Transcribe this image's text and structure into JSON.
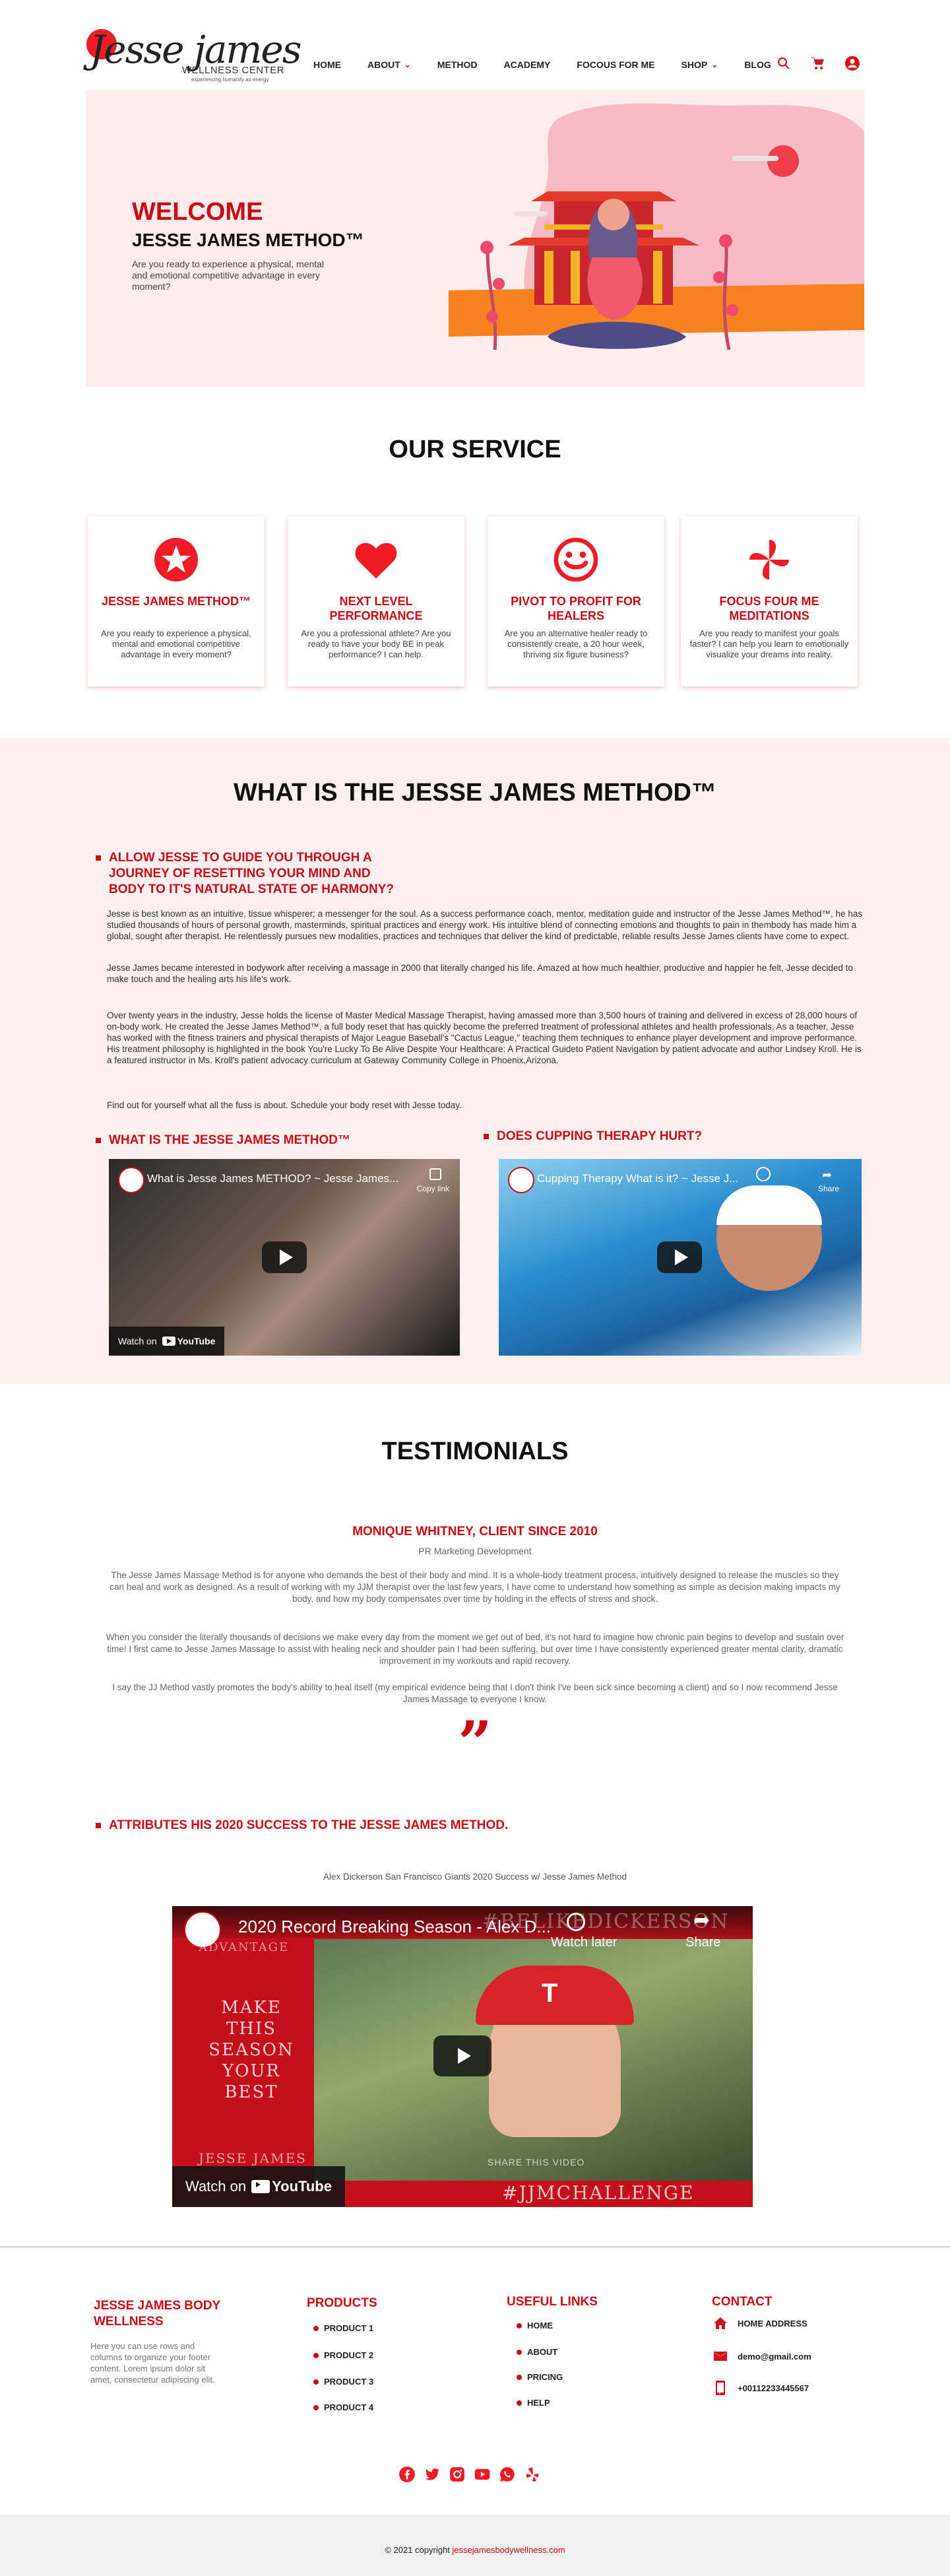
{
  "header": {
    "logo_script": "Jesse james",
    "logo_sub": "WELLNESS CENTER",
    "logo_tag": "experiencing humanity as energy",
    "nav": [
      {
        "label": "HOME",
        "dropdown": false
      },
      {
        "label": "ABOUT",
        "dropdown": true
      },
      {
        "label": "METHOD",
        "dropdown": false
      },
      {
        "label": "ACADEMY",
        "dropdown": false
      },
      {
        "label": "FOCOUS FOR ME",
        "dropdown": false
      },
      {
        "label": "SHOP",
        "dropdown": true
      },
      {
        "label": "BLOG",
        "dropdown": false
      }
    ],
    "icons": [
      "search-icon",
      "cart-icon",
      "account-icon"
    ]
  },
  "hero": {
    "title": "WELCOME",
    "subtitle": "JESSE JAMES METHOD™",
    "text": "Are you ready to experience a physical, mental and emotional competitive advantage in every moment?"
  },
  "service": {
    "title": "OUR SERVICE",
    "cards": [
      {
        "icon": "star-icon",
        "title": "JESSE JAMES METHOD™",
        "text": "Are you ready to experience a physical, mental and emotional competitive advantage in every moment?"
      },
      {
        "icon": "heart-icon",
        "title": "NEXT LEVEL PERFORMANCE",
        "text": "Are you a professional athlete? Are you ready to have your body BE in peak performance? I can help."
      },
      {
        "icon": "smiley-icon",
        "title": "PIVOT TO PROFIT FOR HEALERS",
        "text": "Are you an alternative healer ready to consistently create, a 20 hour week, thriving six figure business?"
      },
      {
        "icon": "pinwheel-icon",
        "title": "FOCUS FOUR ME MEDITATIONS",
        "text": "Are you ready to manifest your goals faster? I can help you learn to emotionally visualize your dreams into reality."
      }
    ]
  },
  "method": {
    "title": "WHAT IS THE JESSE JAMES METHOD™",
    "heading": "ALLOW JESSE TO GUIDE YOU THROUGH A JOURNEY OF RESETTING YOUR MIND AND BODY TO IT'S NATURAL STATE OF HARMONY?",
    "paragraphs": [
      "Jesse is best known as an intuitive, tissue whisperer; a messenger for the soul. As a success performance coach, mentor, meditation guide and instructor of the Jesse James Method™, he has studied thousands of hours of personal growth, masterminds, spiritual practices and energy work. His intuitive blend of connecting emotions and thoughts to pain in thembody has made him a global, sought after therapist. He relentlessly pursues new modalities, practices and techniques that deliver the kind of predictable, reliable results Jesse James clients have come to expect.",
      "Jesse James became interested in bodywork after receiving a massage in 2000 that literally changed his life. Amazed at how much healthier, productive and happier he felt, Jesse decided to make touch and the healing arts his life's work.",
      "Over twenty years in the industry, Jesse holds the license of Master Medical Massage Therapist, having amassed more than 3,500 hours of training and delivered in excess of 28,000 hours of on-body work. He created the Jesse James Method™, a full body reset that has quickly become the preferred treatment of professional athletes and health professionals. As a teacher, Jesse has worked with the fitness trainers and physical therapists of Major League Baseball's \"Cactus League,\" teaching them techniques to enhance player development and improve performance. His treatment philosophy is highlighted in the book You're Lucky To Be Alive Despite Your Healthcare: A Practical Guideto Patient Navigation by patient advocate and author Lindsey Kroll. He is a featured instructor in Ms. Kroll's patient advocacy curriculum at Gateway Community College in Phoenix,Arizona.",
      "Find out for yourself what all the fuss is about. Schedule your body reset with Jesse today."
    ],
    "video1_heading": "WHAT IS THE JESSE JAMES METHOD™",
    "video1_title": "What is Jesse James METHOD? ~ Jesse James...",
    "video1_copy": "Copy link",
    "video2_heading": "DOES CUPPING THERAPY HURT?",
    "video2_title": "Cupping Therapy What is it? ~ Jesse J...",
    "video2_watch_later": "Watch later",
    "video2_share": "Share",
    "watch_on": "Watch on",
    "youtube": "YouTube"
  },
  "testimonials": {
    "title": "TESTIMONIALS",
    "name": "MONIQUE WHITNEY, CLIENT SINCE 2010",
    "role": "PR Marketing Development",
    "paragraphs": [
      "The Jesse James Massage Method is for anyone who demands the best of their body and mind. It is a whole-body treatment process, intuitively designed to release the muscles so they can heal and work as designed. As a result of working with my JJM therapist over the last few years, I have come to understand how something as simple as decision making impacts my body, and how my body compensates over time by holding in the effects of stress and shock.",
      "When you consider the literally thousands of decisions we make every day from the moment we get out of bed, it's not hard to imagine how chronic pain begins to develop and sustain over time! I first came to Jesse James Massage to assist with healing neck and shoulder pain I had been suffering, but over time I have consistently experienced greater mental clarity, dramatic improvement in my workouts and rapid recovery.",
      "I say the JJ Method vastly promotes the body's ability to heal itself (my empirical evidence being that I don't think I've been sick since becoming a client) and so I now recommend Jesse James Massage to everyone I know."
    ],
    "quote_mark": "”"
  },
  "attributes": {
    "heading": "ATTRIBUTES HIS 2020 SUCCESS TO THE JESSE JAMES METHOD.",
    "caption": "Alex Dickerson San Francisco Giants 2020 Success w/ Jesse James Method",
    "video_title": "2020 Record Breaking Season - Alex D...",
    "watch_later": "Watch later",
    "share": "Share",
    "overlay_top": "#BELIKEDICKERSON",
    "overlay_left_top": "ADVANTAGE",
    "overlay_left_main": "MAKE THIS SEASON YOUR BEST",
    "overlay_left_bottom": "JESSE JAMES",
    "overlay_share": "SHARE THIS VIDEO",
    "overlay_hashtag": "#JJMCHALLENGE",
    "watch_on": "Watch on",
    "youtube": "YouTube"
  },
  "footer": {
    "brand_title": "JESSE JAMES BODY WELLNESS",
    "brand_text": "Here you can use rows and columns to organize your footer content. Lorem ipsum dolor sit amet, consectetur adipiscing elit.",
    "products_title": "PRODUCTS",
    "products": [
      "PRODUCT 1",
      "PRODUCT 2",
      "PRODUCT 3",
      "PRODUCT 4"
    ],
    "links_title": "USEFUL LINKS",
    "links": [
      "HOME",
      "ABOUT",
      "PRICING",
      "HELP"
    ],
    "contact_title": "CONTACT",
    "contact": [
      {
        "icon": "home-icon",
        "text": "HOME ADDRESS"
      },
      {
        "icon": "mail-icon",
        "text": "demo@gmail.com"
      },
      {
        "icon": "phone-icon",
        "text": "+00112233445567"
      }
    ],
    "social": [
      "facebook-icon",
      "twitter-icon",
      "instagram-icon",
      "youtube-icon",
      "whatsapp-icon",
      "yelp-icon"
    ],
    "copyright_prefix": "© 2021 copyright",
    "copyright_link": "jessejamesbodywellness.com"
  },
  "colors": {
    "accent": "#cc0a13",
    "hero_bg": "#fdecec",
    "section_bg": "#fdf0f0"
  }
}
